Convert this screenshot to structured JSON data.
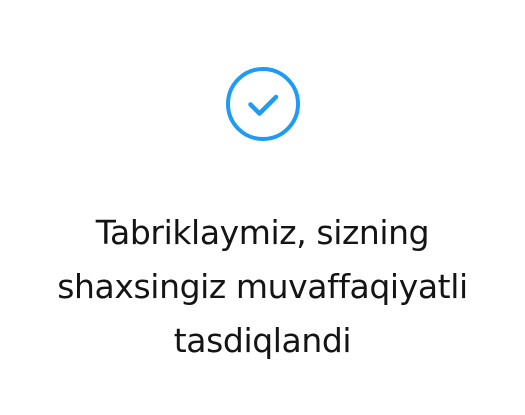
{
  "status": {
    "icon": "check-circle-icon",
    "accent_color": "#1e9bf2",
    "message_lines": [
      "Tabriklaymiz, sizning",
      "shaxsingiz muvaffaqiyatli",
      "tasdiqlandi"
    ]
  }
}
